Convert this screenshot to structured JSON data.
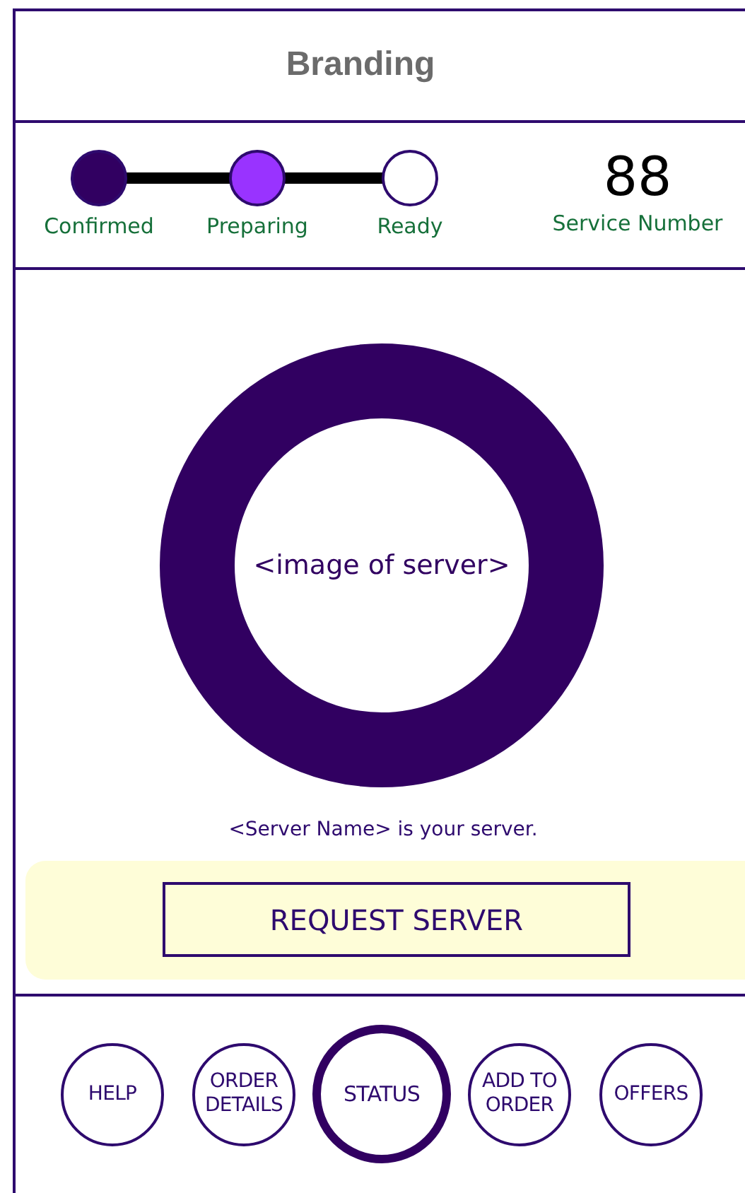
{
  "header": {
    "title": "Branding"
  },
  "progress": {
    "steps": [
      {
        "label": "Confirmed",
        "done": true,
        "current": false
      },
      {
        "label": "Preparing",
        "done": false,
        "current": true
      },
      {
        "label": "Ready",
        "done": false,
        "current": false
      }
    ],
    "service_number": {
      "value": "88",
      "label": "Service Number"
    }
  },
  "server": {
    "image_placeholder": "<image of server>",
    "caption": "<Server Name> is your server."
  },
  "request_button": "REQUEST SERVER",
  "nav": [
    {
      "label": "HELP",
      "selected": false
    },
    {
      "label": "ORDER DETAILS",
      "selected": false
    },
    {
      "label": "STATUS",
      "selected": true
    },
    {
      "label": "ADD TO ORDER",
      "selected": false
    },
    {
      "label": "OFFERS",
      "selected": false
    }
  ]
}
